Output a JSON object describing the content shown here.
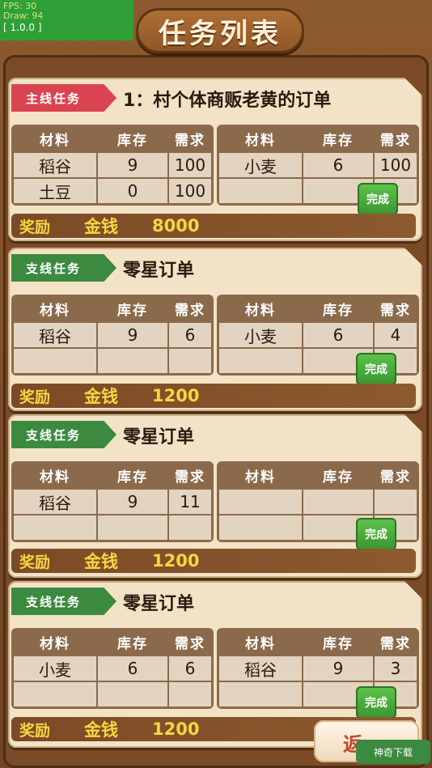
{
  "debug": {
    "fps": "FPS: 30",
    "draw": "Draw: 94",
    "version": "[ 1.0.0 ]"
  },
  "title": "任务列表",
  "headers": {
    "material": "材料",
    "stock": "库存",
    "need": "需求"
  },
  "done_label": "完成",
  "reward_label": "奖励",
  "money_label": "金钱",
  "back_label": "返",
  "watermark": "神奇下载",
  "tasks": [
    {
      "tag": "主线任务",
      "name": "1：村个体商贩老黄的订单",
      "left": [
        {
          "item": "稻谷",
          "stock": "9",
          "need": "100"
        },
        {
          "item": "土豆",
          "stock": "0",
          "need": "100"
        }
      ],
      "right": [
        {
          "item": "小麦",
          "stock": "6",
          "need": "100"
        },
        {
          "item": "",
          "stock": "",
          "need": ""
        }
      ],
      "reward": "8000"
    },
    {
      "tag": "支线任务",
      "name": "零星订单",
      "left": [
        {
          "item": "稻谷",
          "stock": "9",
          "need": "6"
        },
        {
          "item": "",
          "stock": "",
          "need": ""
        }
      ],
      "right": [
        {
          "item": "小麦",
          "stock": "6",
          "need": "4"
        },
        {
          "item": "",
          "stock": "",
          "need": ""
        }
      ],
      "reward": "1200"
    },
    {
      "tag": "支线任务",
      "name": "零星订单",
      "left": [
        {
          "item": "稻谷",
          "stock": "9",
          "need": "11"
        },
        {
          "item": "",
          "stock": "",
          "need": ""
        }
      ],
      "right": [
        {
          "item": "",
          "stock": "",
          "need": ""
        },
        {
          "item": "",
          "stock": "",
          "need": ""
        }
      ],
      "reward": "1200"
    },
    {
      "tag": "支线任务",
      "name": "零星订单",
      "left": [
        {
          "item": "小麦",
          "stock": "6",
          "need": "6"
        },
        {
          "item": "",
          "stock": "",
          "need": ""
        }
      ],
      "right": [
        {
          "item": "稻谷",
          "stock": "9",
          "need": "3"
        },
        {
          "item": "",
          "stock": "",
          "need": ""
        }
      ],
      "reward": "1200"
    }
  ]
}
